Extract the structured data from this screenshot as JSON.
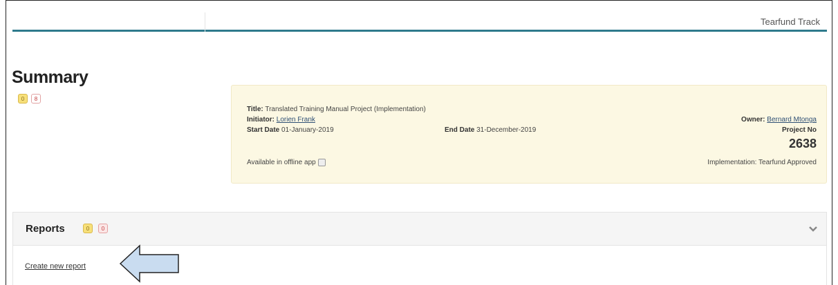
{
  "header": {
    "brand": "Tearfund Track"
  },
  "summary": {
    "heading": "Summary",
    "badge_count": "0",
    "doc_badge": "8"
  },
  "project": {
    "title_label": "Title:",
    "title_value": "Translated Training Manual Project (Implementation)",
    "initiator_label": "Initiator:",
    "initiator_value": "Lorien Frank",
    "start_label": "Start Date",
    "start_value": "01-January-2019",
    "end_label": "End Date",
    "end_value": "31-December-2019",
    "owner_label": "Owner:",
    "owner_value": "Bernard Mtonga",
    "project_no_label": "Project No",
    "project_no_value": "2638",
    "offline_label": "Available in offline app",
    "offline_checked": false,
    "status_text": "Implementation: Tearfund Approved"
  },
  "reports": {
    "heading": "Reports",
    "yellow_count": "0",
    "red_count": "0",
    "create_link": "Create new report"
  },
  "icons": {
    "expand": "chevron-down-icon",
    "arrow": "arrow-left-icon"
  },
  "colors": {
    "accent": "#2e7a8c",
    "panel_bg": "#fcf8e3",
    "arrow_fill": "#c9dcf0",
    "arrow_stroke": "#222222"
  }
}
